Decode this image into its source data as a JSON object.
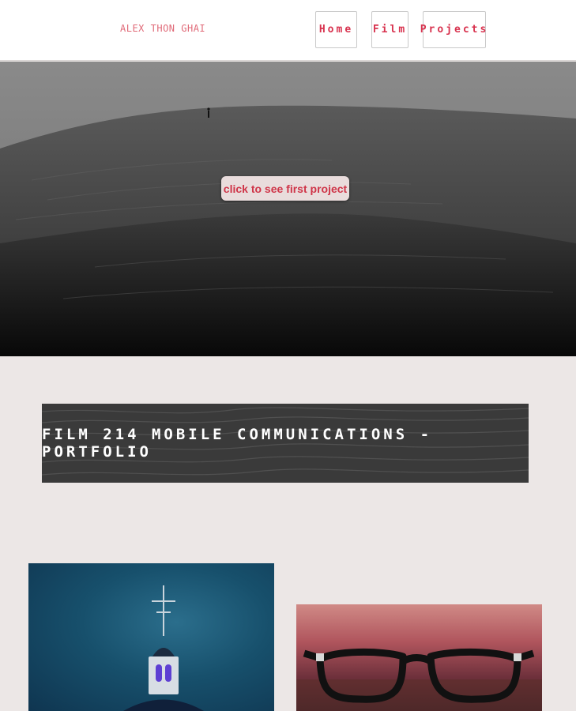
{
  "header": {
    "brand": "ALEX THON GHAI",
    "nav": [
      {
        "label": "Home"
      },
      {
        "label": "Film"
      },
      {
        "label": "Projects"
      }
    ]
  },
  "hero": {
    "cta_label": "click to see first project"
  },
  "banner": {
    "title": "FILM 214 MOBILE COMMUNICATIONS - PORTFOLIO"
  },
  "gallery": [
    {
      "image": "church-steeple-photo"
    },
    {
      "image": "eyeglasses-photo"
    }
  ],
  "colors": {
    "accent": "#d8324e",
    "page_bg": "#ece7e6",
    "brand_text": "#e06a78"
  }
}
